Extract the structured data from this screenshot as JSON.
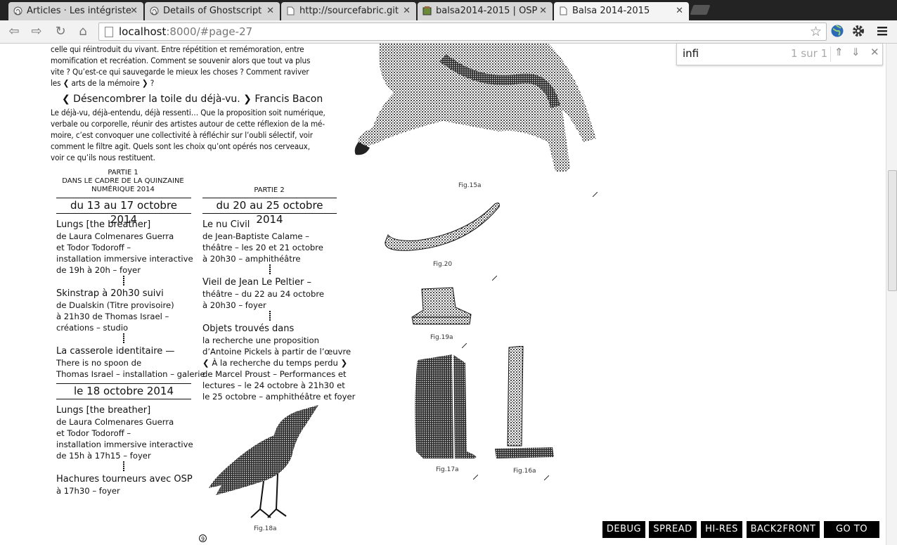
{
  "tabs": [
    {
      "label": "Articles · Les intégriste",
      "icon": "spiral-icon",
      "active": false
    },
    {
      "label": "Details of Ghostscript",
      "icon": "spiral-icon",
      "active": false
    },
    {
      "label": "http://sourcefabric.git",
      "icon": "page-icon",
      "active": false
    },
    {
      "label": "balsa2014-2015 | OSP",
      "icon": "gitorious-icon",
      "active": false
    },
    {
      "label": "Balsa 2014-2015",
      "icon": "page-icon",
      "active": true
    }
  ],
  "toolbar": {
    "url_host": "localhost",
    "url_rest": ":8000/#page-27"
  },
  "find": {
    "query": "infi",
    "count": "1 sur 1"
  },
  "intro": {
    "lines": [
      "celle qui réintroduit du vivant. Entre répétition et remémoration, entre",
      "momification et recréation. Comment se souvenir alors que tout va plus",
      "vite ? Qu’est-ce qui sauvegarde le mieux les choses ? Comment raviver",
      "les ❮ arts de la mémoire ❯ ?"
    ],
    "quote": "❮ Désencombrer la toile du déjà-vu. ❯ Francis Bacon",
    "para": [
      "Le déjà-vu, déjà-entendu, déjà ressenti… Que la proposition soit numérique,",
      "verbale ou corporelle, réunir des artistes autour de cette réflexion de la mé-",
      "moire, c’est convoquer une collectivité à réfléchir sur l’oubli sélectif, voir",
      "comment le filtre agit. Quels sont les choix qu’ont opérés nos cerveaux,",
      "voir ce qu’ils nous restituent."
    ]
  },
  "part1": {
    "label_lines": [
      "PARTIE 1",
      "DANS LE CADRE DE LA QUINZAINE",
      "NUMÉRIQUE 2014"
    ],
    "date_a": "du 13 au 17 octobre 2014",
    "events_a": [
      {
        "title": "Lungs [the breather]",
        "lines": [
          "de Laura Colmenares Guerra",
          "et Todor Todoroff –",
          "installation immersive interactive",
          "de 19h à 20h – foyer"
        ]
      },
      {
        "title": "Skinstrap à 20h30 suivi",
        "lines": [
          "de Dualskin (Titre provisoire)",
          "à 21h30 de Thomas Israel –",
          "créations – studio"
        ]
      },
      {
        "title": "La casserole identitaire —",
        "lines": [
          "There is no spoon de",
          "Thomas Israel – installation – galerie"
        ]
      }
    ],
    "date_b": "le 18 octobre 2014",
    "events_b": [
      {
        "title": "Lungs [the breather]",
        "lines": [
          "de Laura Colmenares Guerra",
          "et Todor Todoroff –",
          "installation immersive interactive",
          "de 15h à 17h15 – foyer"
        ]
      },
      {
        "title": "Hachures tourneurs avec OSP",
        "lines": [
          "à 17h30 – foyer"
        ]
      }
    ]
  },
  "part2": {
    "label": "PARTIE 2",
    "date": "du 20 au 25 octobre 2014",
    "events": [
      {
        "title": "Le nu Civil",
        "lines": [
          "de Jean-Baptiste Calame –",
          "théâtre – les 20 et 21 octobre",
          "à 20h30 – amphithéâtre"
        ]
      },
      {
        "title": "Vieil de Jean Le Peltier –",
        "lines": [
          "théâtre – du 22 au 24 octobre",
          "à 20h30 – foyer"
        ]
      },
      {
        "title": "Objets trouvés dans",
        "lines": [
          "la recherche une proposition",
          "d’Antoine Pickels à partir de l’œuvre",
          "❮ À la recherche du temps perdu ❯",
          "de Marcel Proust – Performances et",
          "lectures – le 24 octobre à 21h30 et",
          "le 25 octobre – amphithéâtre et foyer"
        ]
      }
    ]
  },
  "figures": {
    "fig15a": "Fig.15a",
    "fig20": "Fig.20",
    "fig19a": "Fig.19a",
    "fig17a": "Fig.17a",
    "fig16a": "Fig.16a",
    "fig18a": "Fig.18a"
  },
  "page_number": "9",
  "controls": [
    "DEBUG",
    "SPREAD",
    "HI-RES",
    "BACK2FRONT",
    "GO TO"
  ]
}
